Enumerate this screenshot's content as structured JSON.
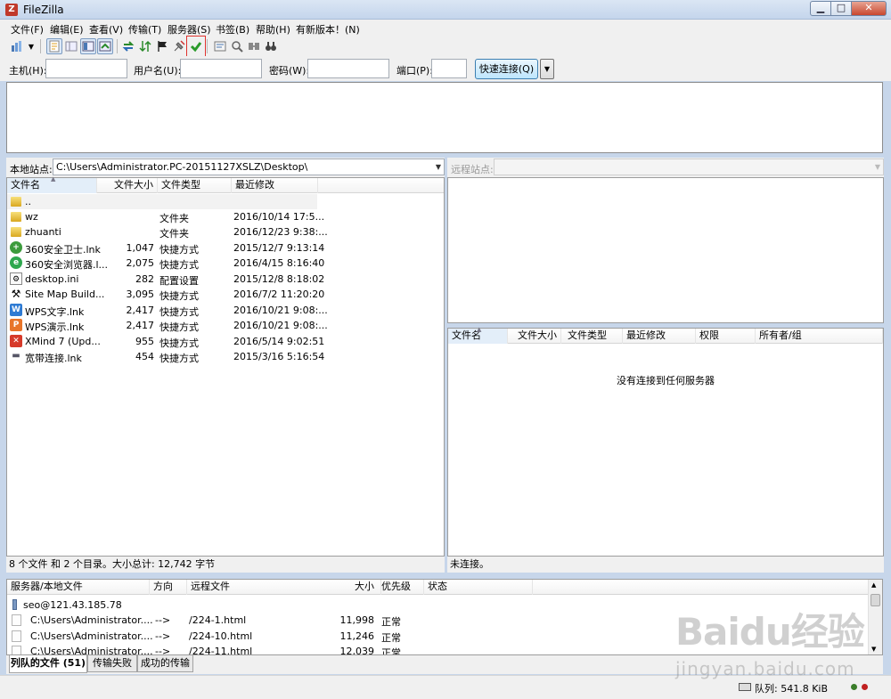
{
  "window": {
    "title": "FileZilla",
    "icon_name": "filezilla-icon",
    "brand_color": "#c0392b"
  },
  "menu": [
    "文件(F)",
    "编辑(E)",
    "查看(V)",
    "传输(T)",
    "服务器(S)",
    "书签(B)",
    "帮助(H)",
    "有新版本！(N)"
  ],
  "toolbar": {
    "icons": [
      "site-manager-icon",
      "site-manager-dropdown-icon",
      "message-log-icon",
      "local-tree-icon",
      "remote-tree-icon",
      "transfer-queue-icon",
      "refresh-icon",
      "process-queue-icon",
      "stop-icon",
      "disconnect-icon",
      "reconnect-icon",
      "directory-filter-icon",
      "toggle-comparison-icon",
      "synchronized-browsing-icon",
      "search-remote-icon"
    ],
    "highlight_color": "#e0322e"
  },
  "quickconnect": {
    "host_label": "主机(H):",
    "host_value": "",
    "user_label": "用户名(U):",
    "user_value": "",
    "pass_label": "密码(W):",
    "pass_value": "",
    "port_label": "端口(P):",
    "port_value": "",
    "button_label": "快速连接(Q)"
  },
  "local": {
    "site_label": "本地站点:",
    "path": "C:\\Users\\Administrator.PC-20151127XSLZ\\Desktop\\",
    "columns": [
      "文件名",
      "文件大小",
      "文件类型",
      "最近修改"
    ],
    "files": [
      {
        "name": "..",
        "size": "",
        "type": "",
        "modified": "",
        "icon": "parent-folder-icon"
      },
      {
        "name": "wz",
        "size": "",
        "type": "文件夹",
        "modified": "2016/10/14 17:5...",
        "icon": "folder-icon"
      },
      {
        "name": "zhuanti",
        "size": "",
        "type": "文件夹",
        "modified": "2016/12/23 9:38:...",
        "icon": "folder-icon"
      },
      {
        "name": "360安全卫士.lnk",
        "size": "1,047",
        "type": "快捷方式",
        "modified": "2015/12/7 9:13:14",
        "icon": "360-safe-icon"
      },
      {
        "name": "360安全浏览器.l...",
        "size": "2,075",
        "type": "快捷方式",
        "modified": "2016/4/15 8:16:40",
        "icon": "360-browser-icon"
      },
      {
        "name": "desktop.ini",
        "size": "282",
        "type": "配置设置",
        "modified": "2015/12/8 8:18:02",
        "icon": "settings-file-icon"
      },
      {
        "name": "Site Map Build...",
        "size": "3,095",
        "type": "快捷方式",
        "modified": "2016/7/2 11:20:20",
        "icon": "sitemap-tool-icon"
      },
      {
        "name": "WPS文字.lnk",
        "size": "2,417",
        "type": "快捷方式",
        "modified": "2016/10/21 9:08:...",
        "icon": "wps-writer-icon"
      },
      {
        "name": "WPS演示.lnk",
        "size": "2,417",
        "type": "快捷方式",
        "modified": "2016/10/21 9:08:...",
        "icon": "wps-presentation-icon"
      },
      {
        "name": "XMind 7 (Upd...",
        "size": "955",
        "type": "快捷方式",
        "modified": "2016/5/14 9:02:51",
        "icon": "xmind-icon"
      },
      {
        "name": "宽带连接.lnk",
        "size": "454",
        "type": "快捷方式",
        "modified": "2015/3/16 5:16:54",
        "icon": "broadband-connection-icon"
      }
    ],
    "status": "8 个文件 和 2 个目录。大小总计: 12,742 字节"
  },
  "remote": {
    "site_label": "远程站点:",
    "path": "",
    "columns": [
      "文件名",
      "文件大小",
      "文件类型",
      "最近修改",
      "权限",
      "所有者/组"
    ],
    "empty_message": "没有连接到任何服务器",
    "status": "未连接。"
  },
  "queue": {
    "columns": [
      "服务器/本地文件",
      "方向",
      "远程文件",
      "大小",
      "优先级",
      "状态"
    ],
    "server": "seo@121.43.185.78",
    "items": [
      {
        "local": "C:\\Users\\Administrator....",
        "direction": "-->",
        "remote": "/224-1.html",
        "size": "11,998",
        "priority": "正常"
      },
      {
        "local": "C:\\Users\\Administrator....",
        "direction": "-->",
        "remote": "/224-10.html",
        "size": "11,246",
        "priority": "正常"
      },
      {
        "local": "C:\\Users\\Administrator....",
        "direction": "-->",
        "remote": "/224-11.html",
        "size": "12,039",
        "priority": "正常"
      }
    ],
    "tabs": [
      "列队的文件 (51)",
      "传输失败",
      "成功的传输"
    ]
  },
  "statusbar": {
    "queue_label": "队列: 541.8 KiB",
    "led_colors": [
      "#3a7d2a",
      "#c02020"
    ]
  },
  "watermark": {
    "main": "Baidu经验",
    "sub": "jingyan.baidu.com"
  }
}
